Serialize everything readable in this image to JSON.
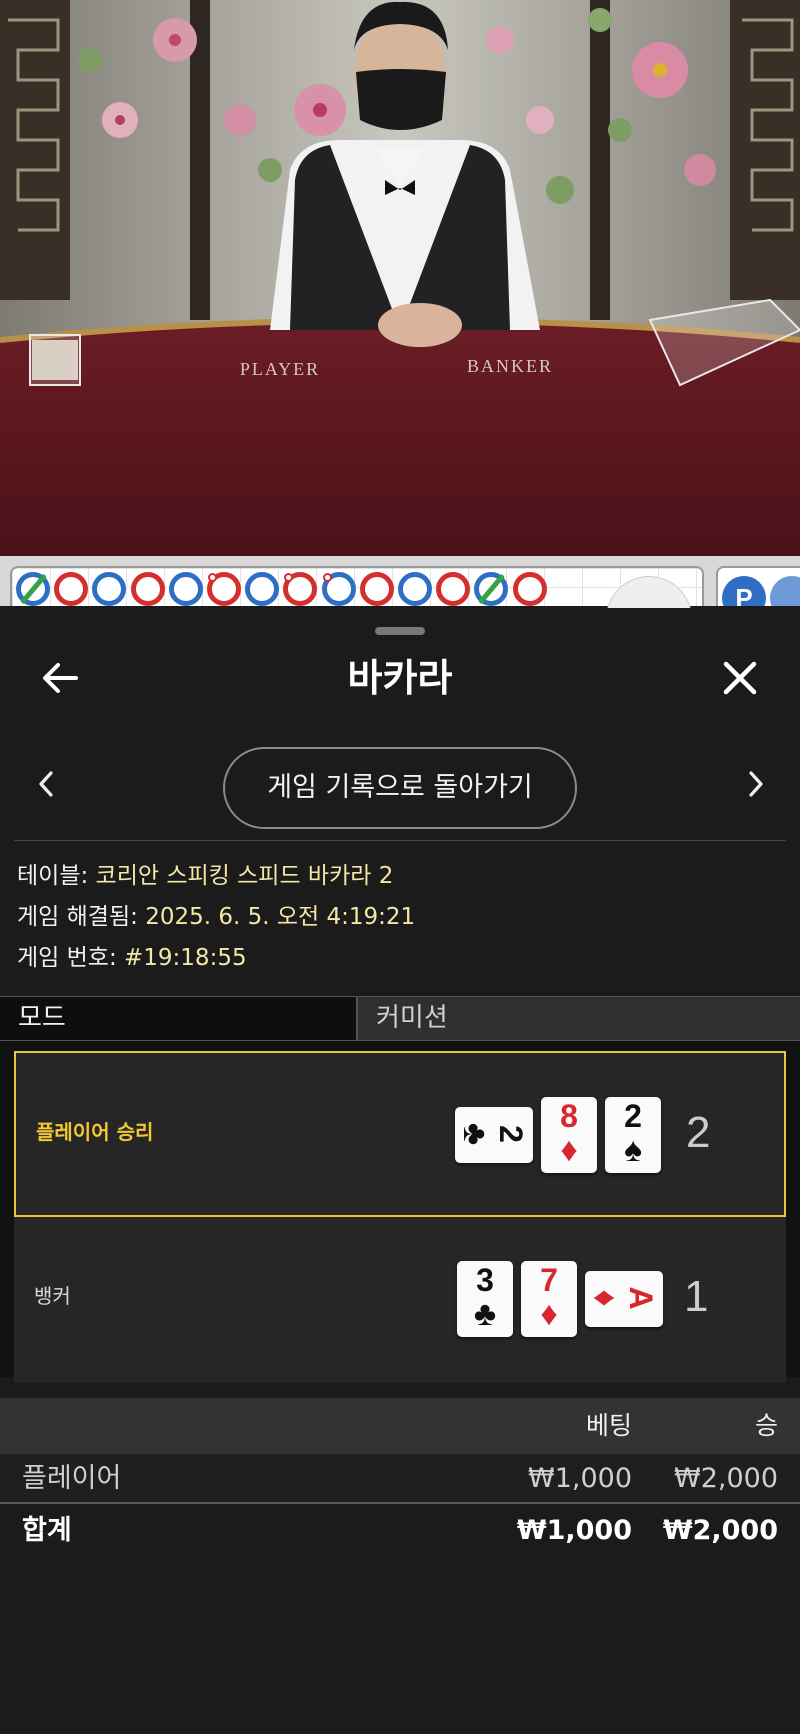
{
  "video": {
    "table_labels": {
      "player": "PLAYER",
      "banker": "BANKER"
    }
  },
  "bead_road": {
    "beads": [
      {
        "winner": "player",
        "tie": true,
        "pair": false
      },
      {
        "winner": "banker",
        "tie": false,
        "pair": false
      },
      {
        "winner": "player",
        "tie": false,
        "pair": false
      },
      {
        "winner": "banker",
        "tie": false,
        "pair": false
      },
      {
        "winner": "player",
        "tie": false,
        "pair": false
      },
      {
        "winner": "banker",
        "tie": false,
        "pair": true
      },
      {
        "winner": "player",
        "tie": false,
        "pair": false
      },
      {
        "winner": "banker",
        "tie": false,
        "pair": true
      },
      {
        "winner": "player",
        "tie": false,
        "pair": true
      },
      {
        "winner": "banker",
        "tie": false,
        "pair": false
      },
      {
        "winner": "player",
        "tie": false,
        "pair": false
      },
      {
        "winner": "banker",
        "tie": false,
        "pair": false
      },
      {
        "winner": "player",
        "tie": true,
        "pair": false
      },
      {
        "winner": "banker",
        "tie": false,
        "pair": false
      }
    ],
    "predict_label": "P"
  },
  "sheet": {
    "title": "바카라",
    "back_icon": "arrow-left-icon",
    "close_icon": "close-icon",
    "history_button": "게임 기록으로 돌아가기"
  },
  "info": {
    "table_label": "테이블:",
    "table_value": "코리안 스피킹 스피드 바카라 2",
    "resolved_label": "게임 해결됨:",
    "resolved_value": "2025. 6. 5. 오전 4:19:21",
    "number_label": "게임 번호:",
    "number_value": "#19:18:55"
  },
  "tabs": {
    "mode": "모드",
    "commission": "커미션"
  },
  "results": {
    "player": {
      "label": "플레이어 승리",
      "score": "2",
      "cards": [
        {
          "rank": "2",
          "suit": "♣",
          "color": "black",
          "sideways": true
        },
        {
          "rank": "8",
          "suit": "♦",
          "color": "red",
          "sideways": false
        },
        {
          "rank": "2",
          "suit": "♠",
          "color": "black",
          "sideways": false
        }
      ]
    },
    "banker": {
      "label": "뱅커",
      "score": "1",
      "cards": [
        {
          "rank": "3",
          "suit": "♣",
          "color": "black",
          "sideways": false
        },
        {
          "rank": "7",
          "suit": "♦",
          "color": "red",
          "sideways": false
        },
        {
          "rank": "A",
          "suit": "♦",
          "color": "red",
          "sideways": true
        }
      ]
    }
  },
  "bets": {
    "header": {
      "bet": "베팅",
      "win": "승"
    },
    "rows": [
      {
        "name": "플레이어",
        "bet": "₩1,000",
        "win": "₩2,000"
      }
    ],
    "total": {
      "name": "합계",
      "bet": "₩1,000",
      "win": "₩2,000"
    }
  },
  "colors": {
    "accent_gold": "#e6c63a",
    "info_value": "#f3e7a7",
    "banker_red": "#d32f2f",
    "player_blue": "#2e6fc4",
    "tie_green": "#33a343"
  }
}
